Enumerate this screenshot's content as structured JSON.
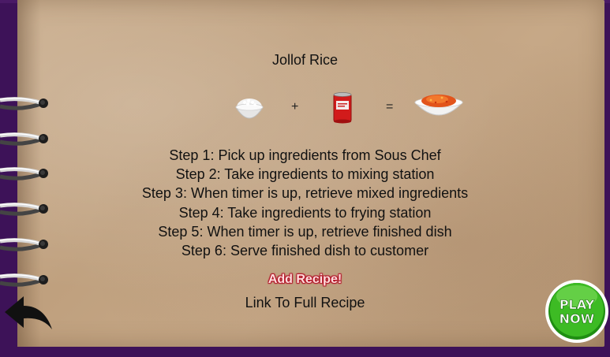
{
  "recipe": {
    "title": "Jollof Rice",
    "equation": {
      "items": [
        "rice-bowl-icon",
        "tomato-can-icon",
        "jollof-dish-icon"
      ],
      "plus": "+",
      "equals": "="
    },
    "steps": [
      "Step 1: Pick up ingredients from Sous Chef",
      "Step 2: Take ingredients to mixing station",
      "Step 3: When timer is up, retrieve mixed ingredients",
      "Step 4: Take ingredients to frying station",
      "Step 5: When timer is up, retrieve finished dish",
      "Step 6: Serve finished dish to customer"
    ],
    "add_recipe_label": "Add Recipe!",
    "full_recipe_link": "Link To Full Recipe"
  },
  "controls": {
    "back_icon": "back-arrow-icon",
    "play_now": {
      "line1": "PLAY",
      "line2": "NOW"
    }
  },
  "colors": {
    "frame": "#3d1258",
    "paper": "#c6a887",
    "add_recipe_outline": "#b3172a",
    "play_green": "#3dbb24"
  }
}
